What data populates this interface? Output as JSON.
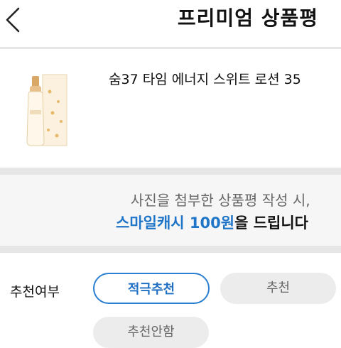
{
  "header": {
    "title": "프리미엄 상품평"
  },
  "product": {
    "name": "숨37 타임 에너지 스위트 로션 35"
  },
  "promo": {
    "line1": "사진을 첨부한 상품평 작성 시,",
    "line2_highlight": "스마일캐시 100원",
    "line2_rest": "을 드립니다"
  },
  "recommend": {
    "label": "추천여부",
    "options": [
      "적극추천",
      "추천",
      "추천안함"
    ],
    "selected": "적극추천"
  },
  "colors": {
    "accent": "#1f76c9",
    "pill_bg": "#ececec",
    "section_bg": "#f6f6f6"
  }
}
